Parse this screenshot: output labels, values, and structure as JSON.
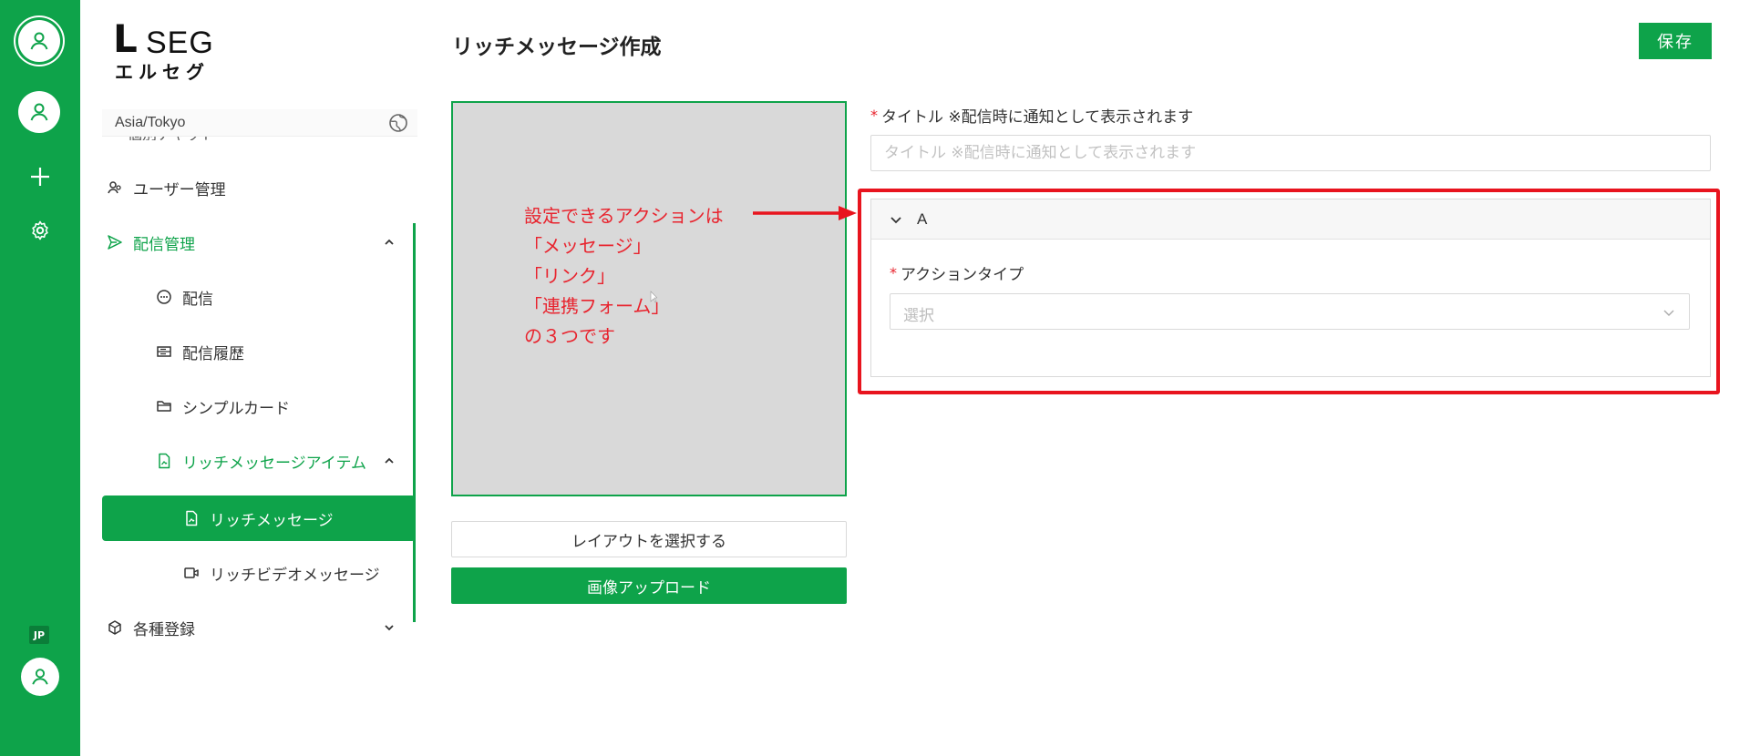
{
  "rail": {
    "lang_badge": "JP"
  },
  "sidebar": {
    "logo_mark": "L",
    "logo_text": "SEG",
    "logo_kana": "エルセグ",
    "timezone": "Asia/Tokyo",
    "cut_item": "個別チャット",
    "items": [
      {
        "label": "ユーザー管理"
      },
      {
        "label": "配信管理"
      },
      {
        "label": "配信"
      },
      {
        "label": "配信履歴"
      },
      {
        "label": "シンプルカード"
      },
      {
        "label": "リッチメッセージアイテム"
      },
      {
        "label": "リッチメッセージ"
      },
      {
        "label": "リッチビデオメッセージ"
      },
      {
        "label": "各種登録"
      }
    ]
  },
  "main": {
    "page_title": "リッチメッセージ作成",
    "save_label": "保存",
    "annotation_lines": [
      "設定できるアクションは",
      "「メッセージ」",
      "「リンク」",
      "「連携フォーム」",
      "の３つです"
    ],
    "layout_button": "レイアウトを選択する",
    "upload_button": "画像アップロード",
    "title_label": "タイトル ※配信時に通知として表示されます",
    "title_placeholder": "タイトル ※配信時に通知として表示されます",
    "required_mark": "*",
    "action_panel": {
      "header": "A",
      "action_type_label": "アクションタイプ",
      "select_placeholder": "選択"
    }
  },
  "colors": {
    "brand_green": "#0ea34a",
    "annotation_red": "#e8242e",
    "frame_red": "#e8141e"
  }
}
